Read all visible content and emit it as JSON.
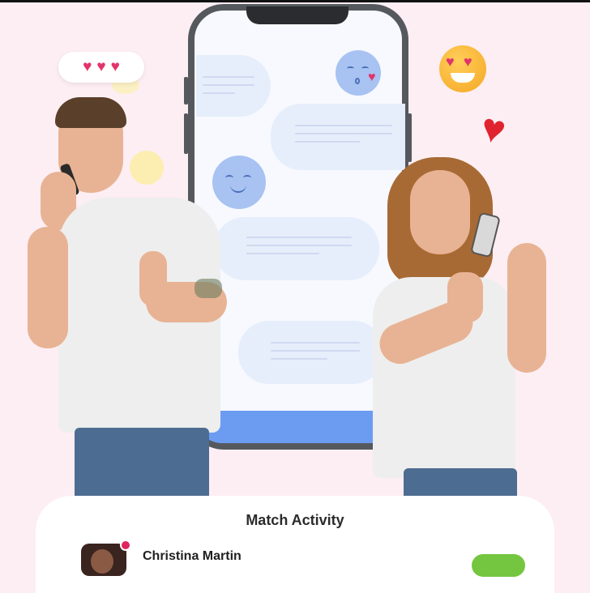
{
  "hero": {
    "hearts": [
      "♥",
      "♥",
      "♥"
    ],
    "floating_heart": "♥"
  },
  "match_activity": {
    "title": "Match Activity",
    "items": [
      {
        "name": "Christina Martin"
      }
    ]
  },
  "colors": {
    "background": "#fdeef3",
    "accent_heart": "#e2336a",
    "phone_frame": "#55595e",
    "chat_bubble": "#e6eefb",
    "phone_bar": "#6b9cf2",
    "action_button": "#74c640"
  }
}
